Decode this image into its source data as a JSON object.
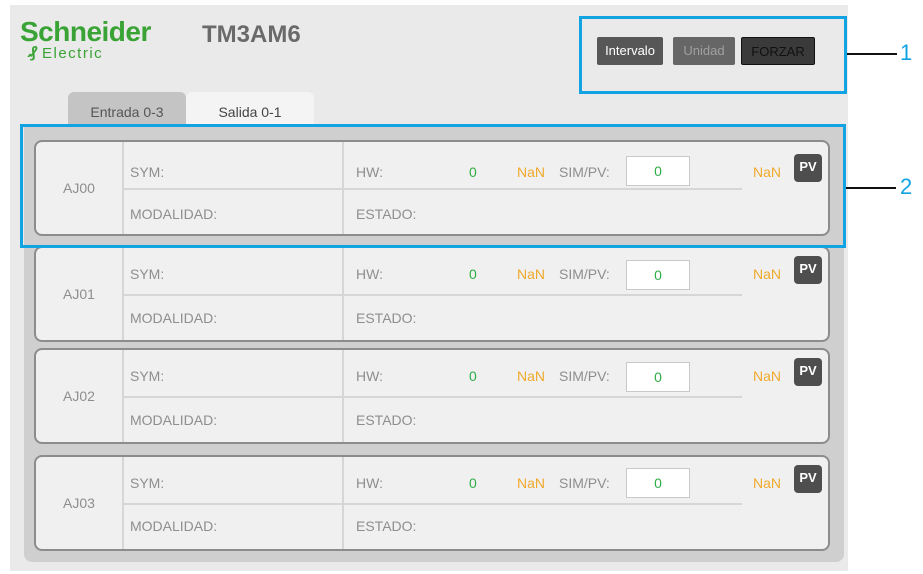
{
  "header": {
    "logo_top": "Schneider",
    "logo_bottom": "Electric",
    "logo_glyph": "₰",
    "model": "TM3AM6"
  },
  "toolbar": {
    "intervalo_label": "Intervalo",
    "unidad_label": "Unidad",
    "forzar_label": "FORZAR"
  },
  "callouts": [
    "1",
    "2"
  ],
  "tabs": [
    {
      "label": "Entrada 0-3"
    },
    {
      "label": "Salida 0-1"
    }
  ],
  "labels": {
    "sym": "SYM:",
    "hw": "HW:",
    "simpv": "SIM/PV:",
    "modalidad": "MODALIDAD:",
    "estado": "ESTADO:",
    "pv": "PV"
  },
  "rows": [
    {
      "id": "AJ00",
      "hw_value": "0",
      "nan_left": "NaN",
      "sim_value": "0",
      "nan_right": "NaN"
    },
    {
      "id": "AJ01",
      "hw_value": "0",
      "nan_left": "NaN",
      "sim_value": "0",
      "nan_right": "NaN"
    },
    {
      "id": "AJ02",
      "hw_value": "0",
      "nan_left": "NaN",
      "sim_value": "0",
      "nan_right": "NaN"
    },
    {
      "id": "AJ03",
      "hw_value": "0",
      "nan_left": "NaN",
      "sim_value": "0",
      "nan_right": "NaN"
    }
  ],
  "colors": {
    "brand_green": "#3aa335",
    "highlight_blue": "#12a3e3",
    "value_green": "#2eae45",
    "nan_orange": "#f0a92c"
  }
}
